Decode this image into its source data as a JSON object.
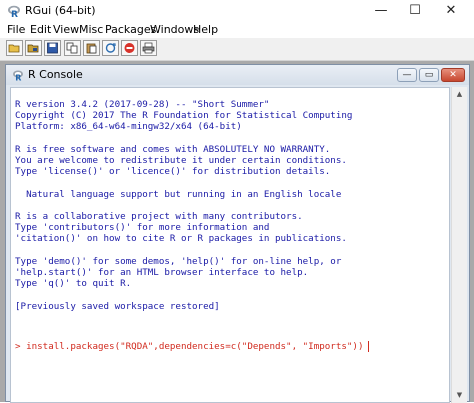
{
  "app": {
    "title": "RGui (64-bit)",
    "controls": {
      "minimize": "—",
      "maximize": "☐",
      "close": "✕"
    }
  },
  "menu": [
    "File",
    "Edit",
    "View",
    "Misc",
    "Packages",
    "Windows",
    "Help"
  ],
  "toolbar": {
    "buttons": [
      "open-script-icon",
      "load-workspace-icon",
      "save-workspace-icon",
      "copy-icon",
      "paste-icon",
      "copy-paste-icon",
      "stop-icon",
      "print-icon"
    ]
  },
  "console_window": {
    "title": "R Console",
    "controls": {
      "minimize": "—",
      "maximize": "▭",
      "close": "✕"
    },
    "output_lines": [
      "R version 3.4.2 (2017-09-28) -- \"Short Summer\"",
      "Copyright (C) 2017 The R Foundation for Statistical Computing",
      "Platform: x86_64-w64-mingw32/x64 (64-bit)",
      "",
      "R is free software and comes with ABSOLUTELY NO WARRANTY.",
      "You are welcome to redistribute it under certain conditions.",
      "Type 'license()' or 'licence()' for distribution details.",
      "",
      "  Natural language support but running in an English locale",
      "",
      "R is a collaborative project with many contributors.",
      "Type 'contributors()' for more information and",
      "'citation()' on how to cite R or R packages in publications.",
      "",
      "Type 'demo()' for some demos, 'help()' for on-line help, or",
      "'help.start()' for an HTML browser interface to help.",
      "Type 'q()' to quit R.",
      "",
      "[Previously saved workspace restored]"
    ],
    "command": "> install.packages(\"RQDA\",dependencies=c(\"Depends\", \"Imports\"))"
  },
  "colors": {
    "output_text": "#1a1aa6",
    "command_text": "#d12b1f",
    "mdi_background": "#a9a9a9"
  }
}
